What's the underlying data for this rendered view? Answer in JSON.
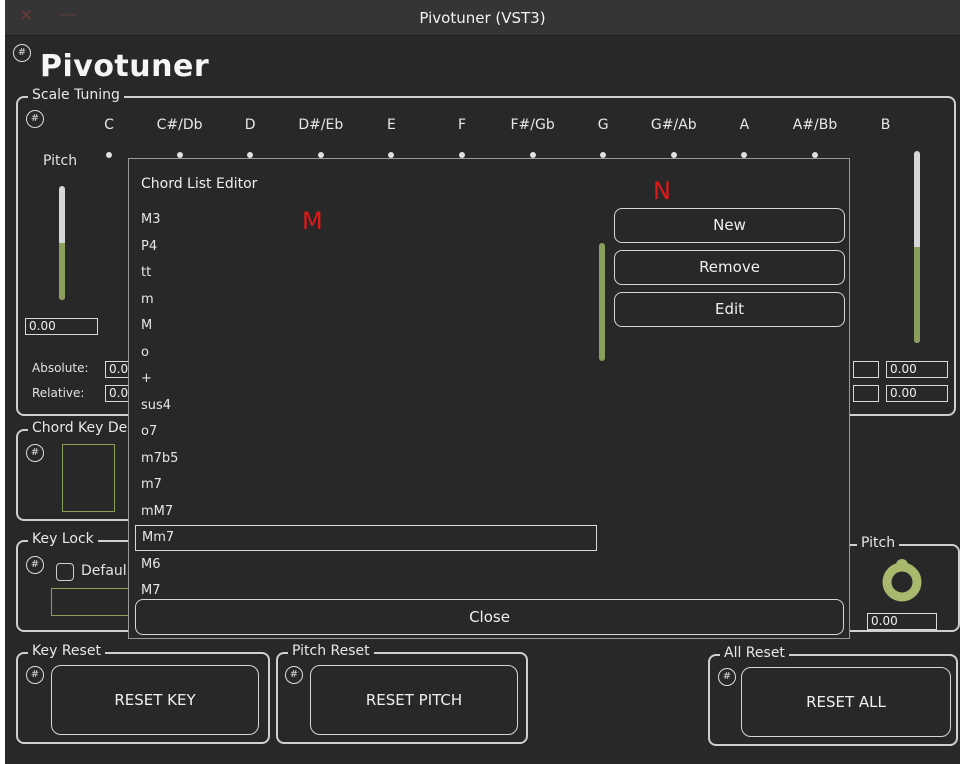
{
  "window": {
    "title": "Pivotuner (VST3)",
    "close_glyph": "✕",
    "minimize_glyph": "—"
  },
  "app": {
    "title": "Pivotuner",
    "hash_glyph": "#"
  },
  "scale_tuning": {
    "label": "Scale Tuning",
    "pitch_label": "Pitch",
    "pitch_value": "0.00",
    "absolute_label": "Absolute:",
    "relative_label": "Relative:",
    "absolute_left_value": "0.0",
    "relative_left_value": "0.0",
    "absolute_right_value": "0.00",
    "relative_right_value": "0.00",
    "notes": [
      "C",
      "C#/Db",
      "D",
      "D#/Eb",
      "E",
      "F",
      "F#/Gb",
      "G",
      "G#/Ab",
      "A",
      "A#/Bb",
      "B"
    ],
    "left_slider_level": 0.5,
    "right_slider_level": 0.5
  },
  "chord_key_detect": {
    "label": "Chord Key De"
  },
  "key_lock": {
    "label": "Key Lock",
    "default_label": "Defaul"
  },
  "pitch_panel": {
    "label": "Pitch",
    "value": "0.00"
  },
  "key_reset": {
    "label": "Key Reset",
    "button": "RESET KEY"
  },
  "pitch_reset": {
    "label": "Pitch Reset",
    "button": "RESET PITCH"
  },
  "all_reset": {
    "label": "All Reset",
    "button": "RESET ALL"
  },
  "dialog": {
    "title": "Chord List Editor",
    "marker_m": "M",
    "marker_n": "N",
    "items": [
      "M3",
      "P4",
      "tt",
      "m",
      "M",
      "o",
      "+",
      "sus4",
      "o7",
      "m7b5",
      "m7",
      "mM7",
      "Mm7",
      "M6",
      "M7"
    ],
    "selected_item": "Mm7",
    "buttons": {
      "new": "New",
      "remove": "Remove",
      "edit": "Edit",
      "close": "Close"
    }
  },
  "colors": {
    "accent": "#8aa05a",
    "background": "#282828",
    "marker": "#e01a1a"
  }
}
